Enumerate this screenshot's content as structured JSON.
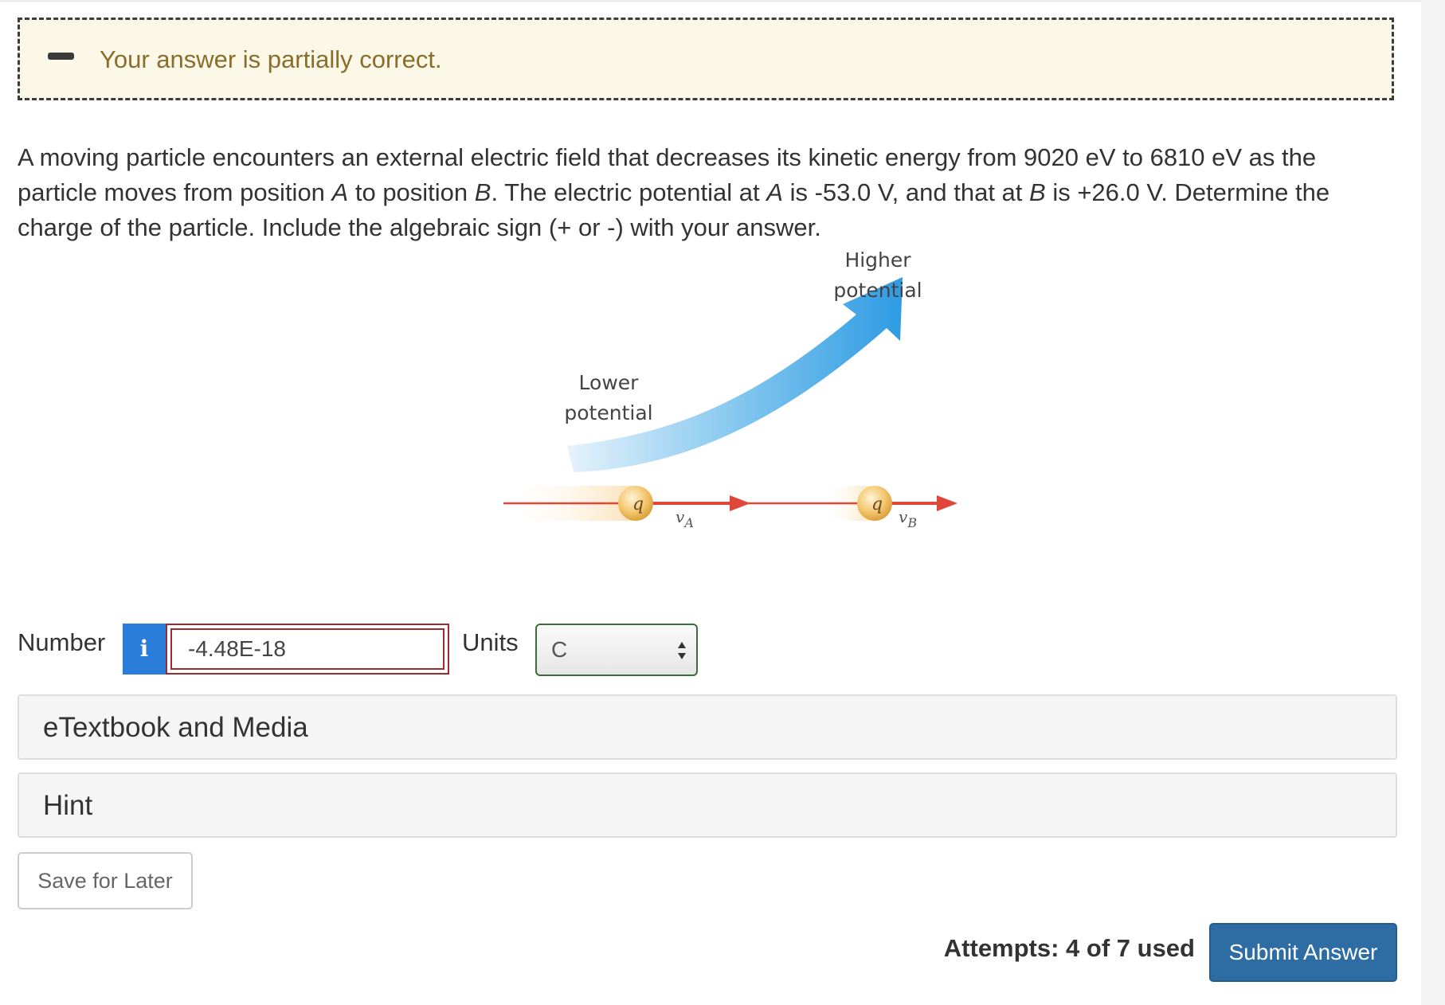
{
  "feedback": {
    "message": "Your answer is partially correct.",
    "icon": "minus-icon"
  },
  "question": {
    "part1": "A moving particle encounters an external electric field that decreases its kinetic energy from 9020 eV to 6810 eV as the particle moves from position ",
    "pos_a": "A",
    "part2": " to position ",
    "pos_b": "B",
    "part3": ". The electric potential at ",
    "pos_a2": "A",
    "part4": " is -53.0 V, and that at ",
    "pos_b2": "B",
    "part5": " is +26.0 V. Determine the charge of the particle. Include the algebraic sign (+ or -) with your answer."
  },
  "figure": {
    "higher_label": "Higher\npotential",
    "lower_label": "Lower\npotential",
    "charge_symbol": "q",
    "velocity_a": "v",
    "velocity_a_sub": "A",
    "velocity_b": "v",
    "velocity_b_sub": "B",
    "colors": {
      "arrow_blue": "#3aa6e8",
      "velocity_red": "#e0473a",
      "particle": "#f0c070"
    }
  },
  "answer": {
    "number_label": "Number",
    "info_label": "i",
    "number_value": "-4.48E-18",
    "units_label": "Units",
    "units_value": "C"
  },
  "panels": {
    "etextbook": "eTextbook and Media",
    "hint": "Hint"
  },
  "buttons": {
    "save": "Save for Later",
    "submit": "Submit Answer"
  },
  "attempts": "Attempts: 4 of 7 used"
}
